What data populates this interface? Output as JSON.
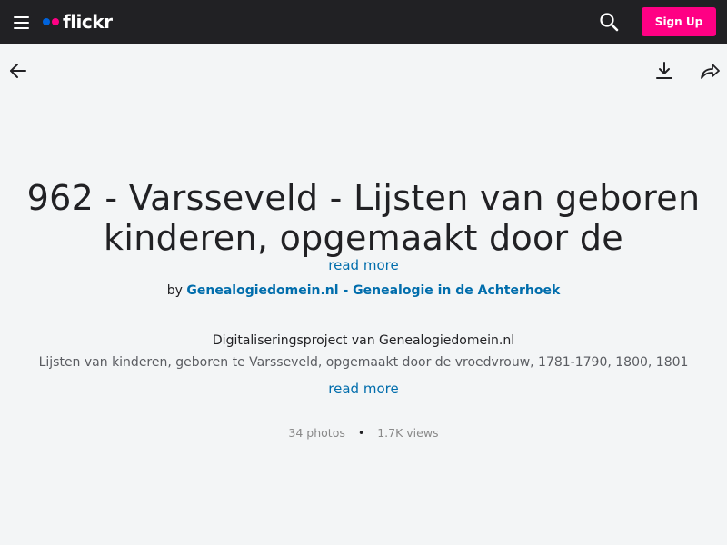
{
  "header": {
    "logo_text": "flickr",
    "signup_label": "Sign Up",
    "icons": {
      "menu": "hamburger-menu-icon",
      "search": "search-icon"
    },
    "colors": {
      "background": "#212124",
      "logo_blue": "#0063dc",
      "logo_pink": "#ff0084",
      "signup": "#ff0084"
    }
  },
  "toolbar": {
    "icons": {
      "back": "arrow-left-icon",
      "download": "download-icon",
      "share": "share-arrow-icon"
    }
  },
  "album": {
    "title_line1": "962 - Varsseveld - Lijsten van geboren",
    "title_line2": "kinderen, opgemaakt door de",
    "read_more_label": "read more",
    "by_prefix": "by",
    "owner_name": "Genealogiedomein.nl - Genealogie in de Achterhoek",
    "description_line1": "Digitaliseringsproject van Genealogiedomein.nl",
    "description_line2": "Lijsten van kinderen, geboren te Varsseveld, opgemaakt door de vroedvrouw, 1781-1790, 1800, 1801",
    "description_read_more": "read more",
    "photo_count": "34 photos",
    "separator": "•",
    "view_count": "1.7K views",
    "link_color": "#006dac"
  }
}
